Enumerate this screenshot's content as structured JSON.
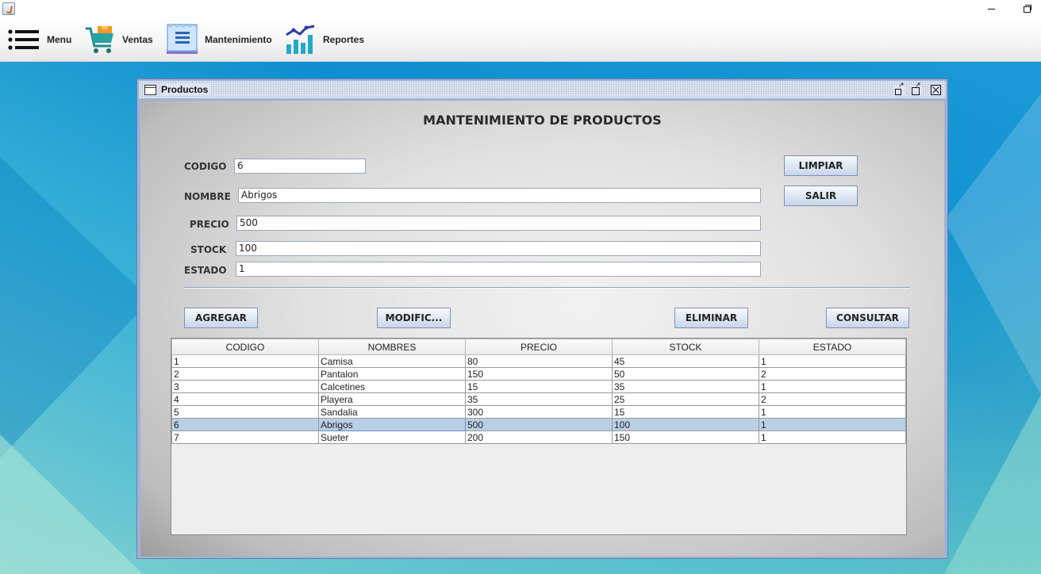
{
  "menubar": {
    "items": [
      {
        "label": "Menu",
        "icon": "hamburger-icon"
      },
      {
        "label": "Ventas",
        "icon": "shopping-cart-icon",
        "mnemonic": "V"
      },
      {
        "label": "Mantenimiento",
        "icon": "clipboard-icon"
      },
      {
        "label": "Reportes",
        "icon": "bar-chart-icon"
      }
    ]
  },
  "frame": {
    "title": "Productos"
  },
  "form": {
    "heading": "MANTENIMIENTO DE PRODUCTOS",
    "codigo_label": "CODIGO",
    "codigo_value": "6",
    "nombre_label": "NOMBRE",
    "nombre_value": "Abrigos",
    "precio_label": "PRECIO",
    "precio_value": "500",
    "stock_label": "STOCK",
    "stock_value": "100",
    "estado_label": "ESTADO",
    "estado_value": "1",
    "limpiar_label": "LIMPIAR",
    "salir_label": "SALIR",
    "agregar_label": "AGREGAR",
    "modificar_label": "MODIFIC...",
    "eliminar_label": "ELIMINAR",
    "consultar_label": "CONSULTAR"
  },
  "table": {
    "headers": [
      "CODIGO",
      "NOMBRES",
      "PRECIO",
      "STOCK",
      "ESTADO"
    ],
    "rows": [
      [
        "1",
        "Camisa",
        "80",
        "45",
        "1"
      ],
      [
        "2",
        "Pantalon",
        "150",
        "50",
        "2"
      ],
      [
        "3",
        "Calcetines",
        "15",
        "35",
        "1"
      ],
      [
        "4",
        "Playera",
        "35",
        "25",
        "2"
      ],
      [
        "5",
        "Sandalia",
        "300",
        "15",
        "1"
      ],
      [
        "6",
        "Abrigos",
        "500",
        "100",
        "1"
      ],
      [
        "7",
        "Sueter",
        "200",
        "150",
        "1"
      ]
    ],
    "selected_row": 5
  },
  "colors": {
    "desktop": "#1a99d6",
    "frame_border": "#6a7fb2",
    "selection": "#b9cfe6"
  }
}
